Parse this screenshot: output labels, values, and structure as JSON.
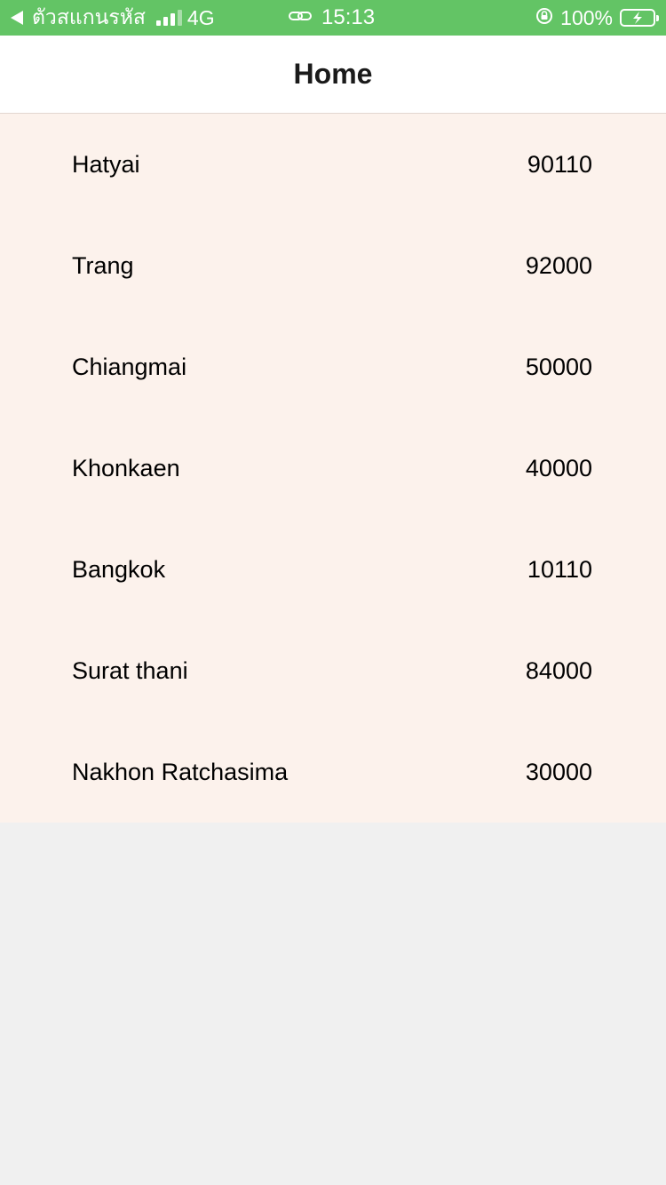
{
  "status_bar": {
    "back_app": "ตัวสแกนรหัส",
    "network": "4G",
    "time": "15:13",
    "battery_percent": "100%",
    "signal_bars_on": 3,
    "signal_bars_total": 4,
    "background_color": "#63c465",
    "icons": [
      "back-arrow-icon",
      "signal-icon",
      "link-icon",
      "rotation-lock-icon",
      "battery-charging-icon"
    ]
  },
  "navbar": {
    "title": "Home"
  },
  "list": {
    "background_color": "#fcf2ec",
    "items": [
      {
        "name": "Hatyai",
        "code": "90110"
      },
      {
        "name": "Trang",
        "code": "92000"
      },
      {
        "name": "Chiangmai",
        "code": "50000"
      },
      {
        "name": "Khonkaen",
        "code": "40000"
      },
      {
        "name": "Bangkok",
        "code": "10110"
      },
      {
        "name": "Surat thani",
        "code": "84000"
      },
      {
        "name": "Nakhon Ratchasima",
        "code": "30000"
      }
    ]
  }
}
